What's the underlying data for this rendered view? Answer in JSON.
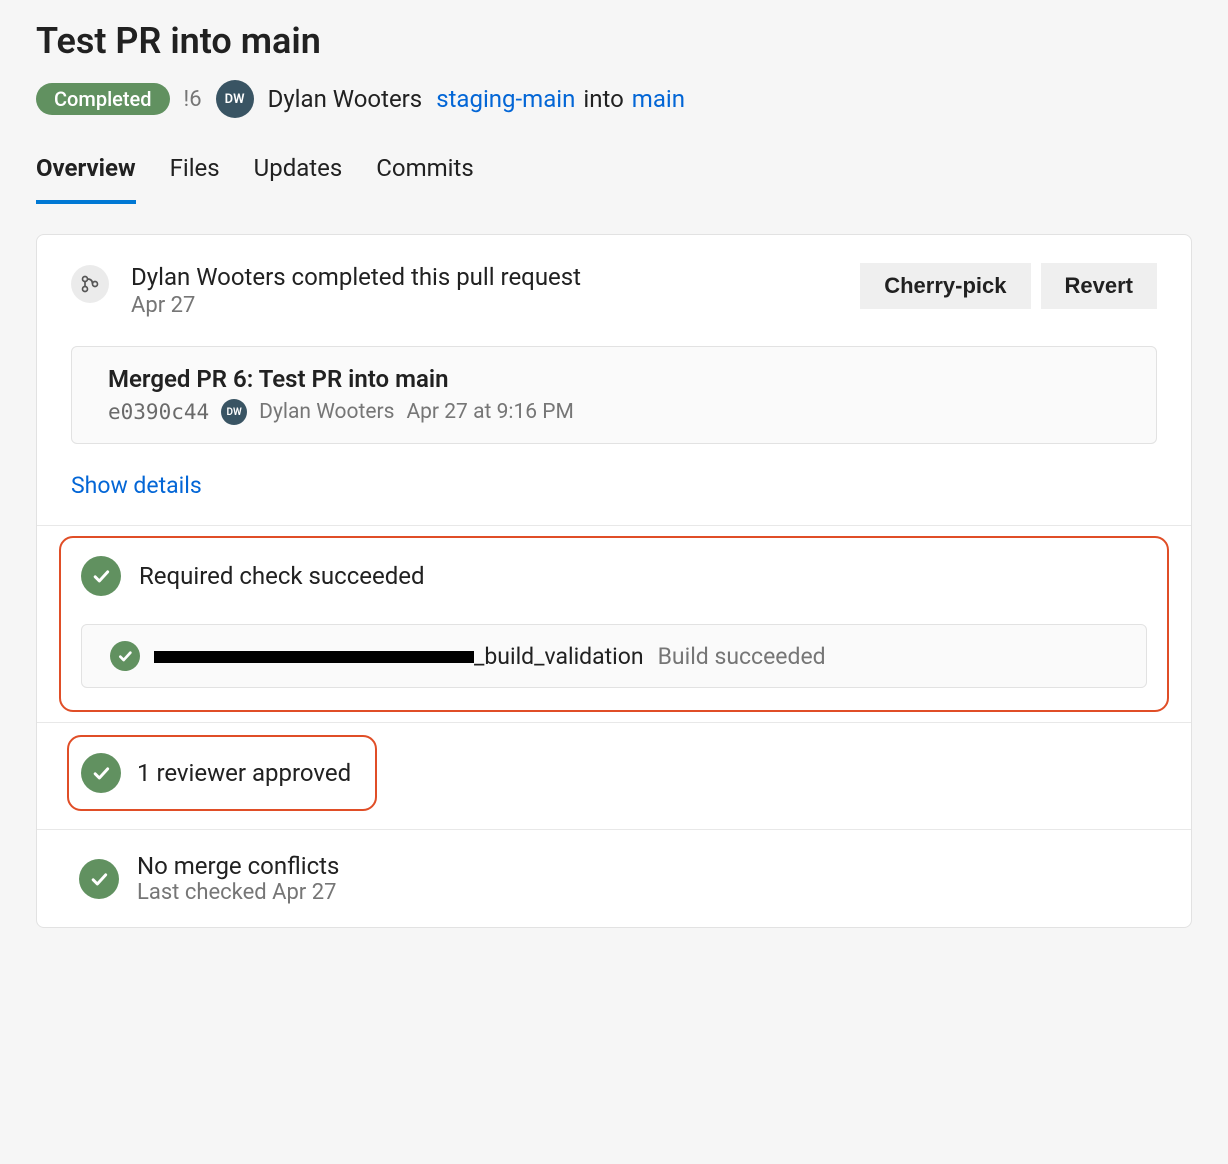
{
  "pr": {
    "title": "Test PR into main",
    "status": "Completed",
    "id_prefix": "!6",
    "author": "Dylan Wooters",
    "avatar_initials": "DW",
    "source_branch": "staging-main",
    "into": "into",
    "target_branch": "main"
  },
  "tabs": {
    "overview": "Overview",
    "files": "Files",
    "updates": "Updates",
    "commits": "Commits"
  },
  "completion": {
    "text": "Dylan Wooters completed this pull request",
    "date": "Apr 27",
    "cherry_pick": "Cherry-pick",
    "revert": "Revert"
  },
  "commit": {
    "title": "Merged PR 6: Test PR into main",
    "hash": "e0390c44",
    "author": "Dylan Wooters",
    "avatar_initials": "DW",
    "timestamp": "Apr 27 at 9:16 PM"
  },
  "show_details": "Show details",
  "check": {
    "title": "Required check succeeded",
    "build_suffix": "_build_validation",
    "build_status": "Build succeeded"
  },
  "reviewer": {
    "text": "1 reviewer approved"
  },
  "merge": {
    "title": "No merge conflicts",
    "sub": "Last checked Apr 27"
  }
}
